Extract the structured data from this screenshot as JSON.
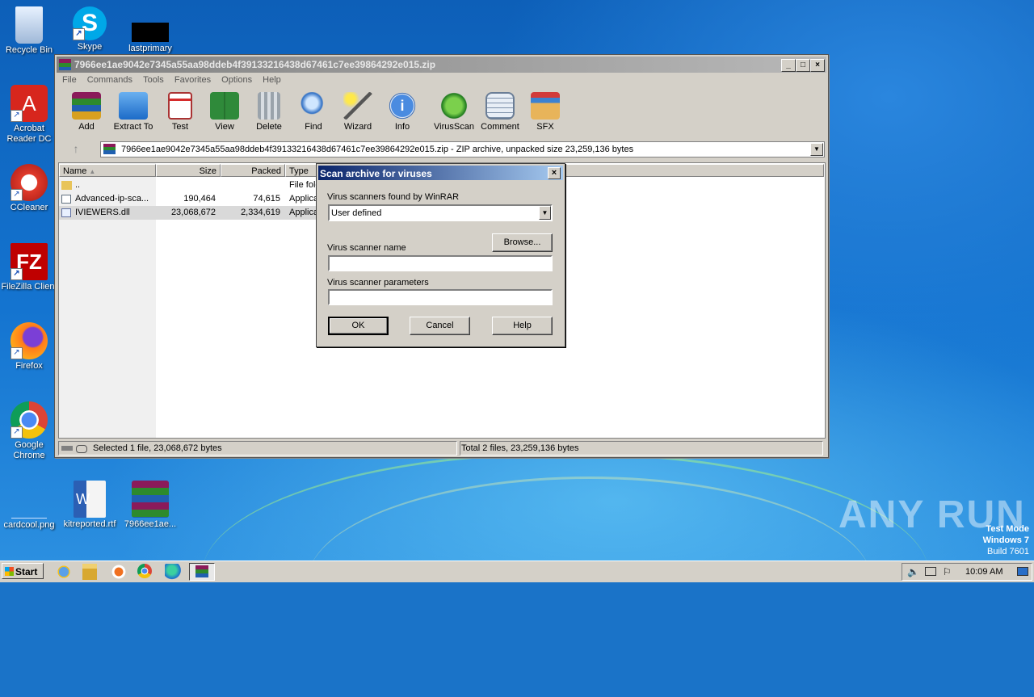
{
  "desktop": {
    "icons": [
      {
        "label": "Recycle Bin"
      },
      {
        "label": "Skype"
      },
      {
        "label": "lastprimary"
      },
      {
        "label": "Acrobat Reader DC"
      },
      {
        "label": "CCleaner"
      },
      {
        "label": "FileZilla Client"
      },
      {
        "label": "Firefox"
      },
      {
        "label": "Google Chrome"
      },
      {
        "label": "cardcool.png"
      },
      {
        "label": "kitreported.rtf"
      },
      {
        "label": "7966ee1ae..."
      }
    ],
    "watermark": "ANY RUN",
    "test_mode": {
      "line1": "Test Mode",
      "line2": "Windows 7",
      "line3": "Build 7601"
    }
  },
  "window": {
    "title": "7966ee1ae9042e7345a55aa98ddeb4f39133216438d67461c7ee39864292e015.zip",
    "menu": [
      "File",
      "Commands",
      "Tools",
      "Favorites",
      "Options",
      "Help"
    ],
    "toolbar": [
      {
        "label": "Add",
        "icon": "add-icon"
      },
      {
        "label": "Extract To",
        "icon": "extract-folder-icon"
      },
      {
        "label": "Test",
        "icon": "test-clipboard-icon"
      },
      {
        "label": "View",
        "icon": "view-book-icon"
      },
      {
        "label": "Delete",
        "icon": "trash-icon"
      },
      {
        "label": "Find",
        "icon": "magnifier-icon"
      },
      {
        "label": "Wizard",
        "icon": "wand-icon"
      },
      {
        "label": "Info",
        "icon": "info-icon"
      },
      {
        "label": "VirusScan",
        "icon": "virus-icon"
      },
      {
        "label": "Comment",
        "icon": "comment-icon"
      },
      {
        "label": "SFX",
        "icon": "sfx-box-icon"
      }
    ],
    "address": "7966ee1ae9042e7345a55aa98ddeb4f39133216438d67461c7ee39864292e015.zip - ZIP archive, unpacked size 23,259,136 bytes",
    "columns": [
      "Name",
      "Size",
      "Packed",
      "Type"
    ],
    "rows": [
      {
        "name": "..",
        "size": "",
        "packed": "",
        "type": "File folder"
      },
      {
        "name": "Advanced-ip-sca...",
        "size": "190,464",
        "packed": "74,615",
        "type": "Application"
      },
      {
        "name": "IVIEWERS.dll",
        "size": "23,068,672",
        "packed": "2,334,619",
        "type": "Application extension"
      }
    ],
    "status_left": "Selected 1 file, 23,068,672 bytes",
    "status_right": "Total 2 files, 23,259,136 bytes"
  },
  "dialog": {
    "title": "Scan archive for viruses",
    "close": "×",
    "scanners_label": "Virus scanners found by WinRAR",
    "scanners_value": "User defined",
    "name_label": "Virus scanner name",
    "browse": "Browse...",
    "params_label": "Virus scanner parameters",
    "ok": "OK",
    "cancel": "Cancel",
    "help": "Help"
  },
  "taskbar": {
    "start": "Start",
    "clock": "10:09 AM"
  }
}
